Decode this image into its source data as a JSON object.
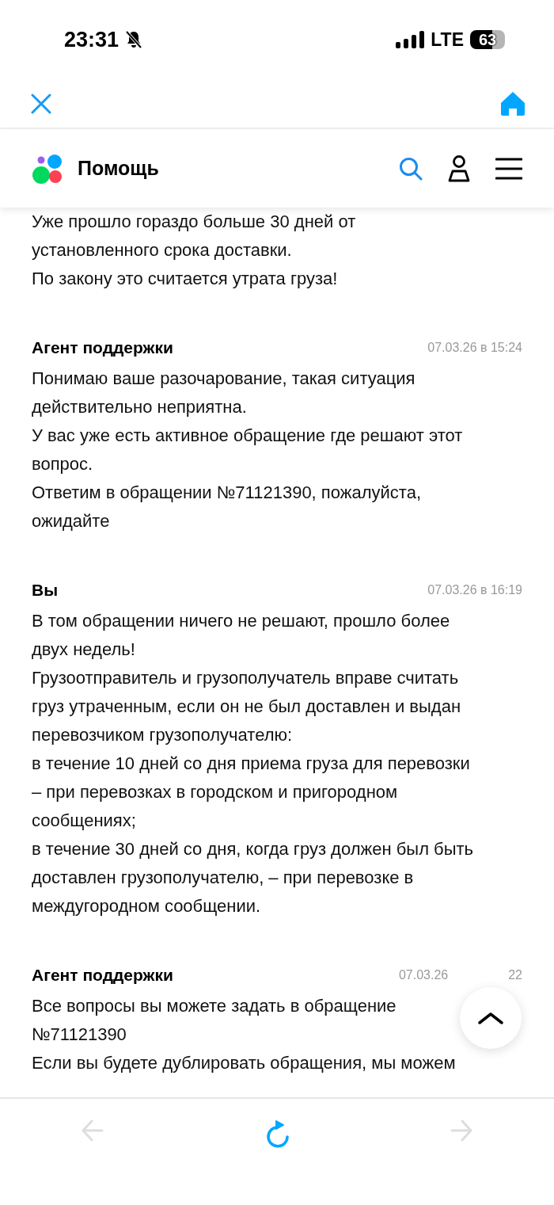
{
  "status_bar": {
    "time": "23:31",
    "network": "LTE",
    "battery": "63"
  },
  "header": {
    "title": "Помощь"
  },
  "messages": [
    {
      "text": "Уже прошло гораздо больше 30 дней от\nустановленного срока доставки.\nПо закону это считается утрата груза!"
    },
    {
      "author": "Агент поддержки",
      "timestamp": "07.03.26 в 15:24",
      "text": "Понимаю ваше разочарование, такая ситуация\nдействительно неприятна.\nУ вас уже есть активное обращение где решают этот\nвопрос.\nОтветим в обращении №71121390, пожалуйста,\nожидайте"
    },
    {
      "author": "Вы",
      "timestamp": "07.03.26 в 16:19",
      "text": "В том обращении ничего не решают, прошло более\nдвух недель!\nГрузоотправитель и грузополучатель вправе считать\nгруз утраченным, если он не был доставлен и выдан\nперевозчиком грузополучателю:\nв течение 10 дней со дня приема груза для перевозки\n– при перевозках в городском и пригородном\nсообщениях;\nв течение 30 дней со дня, когда груз должен был быть\nдоставлен грузополучателю, – при перевозке в\nмеждугородном сообщении."
    },
    {
      "author": "Агент поддержки",
      "timestamp": "07.03.26",
      "timestamp_tail": "22",
      "text": "Все вопросы вы можете задать в обращение\n№71121390\nЕсли вы будете дублировать обращения, мы можем"
    }
  ]
}
